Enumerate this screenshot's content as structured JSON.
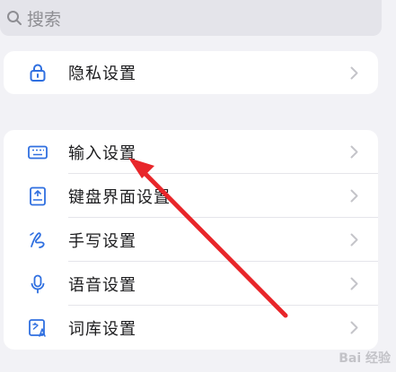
{
  "search": {
    "placeholder": "搜索",
    "icon": "search-icon"
  },
  "privacy": {
    "label": "隐私设置",
    "icon": "lock-icon"
  },
  "settings": [
    {
      "key": "input",
      "label": "输入设置",
      "icon": "keyboard-icon"
    },
    {
      "key": "keyboard-ui",
      "label": "键盘界面设置",
      "icon": "keyboard-layout-icon"
    },
    {
      "key": "handwriting",
      "label": "手写设置",
      "icon": "handwriting-icon"
    },
    {
      "key": "voice",
      "label": "语音设置",
      "icon": "microphone-icon"
    },
    {
      "key": "lexicon",
      "label": "词库设置",
      "icon": "dictionary-icon"
    }
  ],
  "colors": {
    "accent": "#2f6fe0",
    "arrow": "#e8262a",
    "background": "#f2f2f6"
  },
  "watermark": {
    "text": "Bai 经验"
  }
}
